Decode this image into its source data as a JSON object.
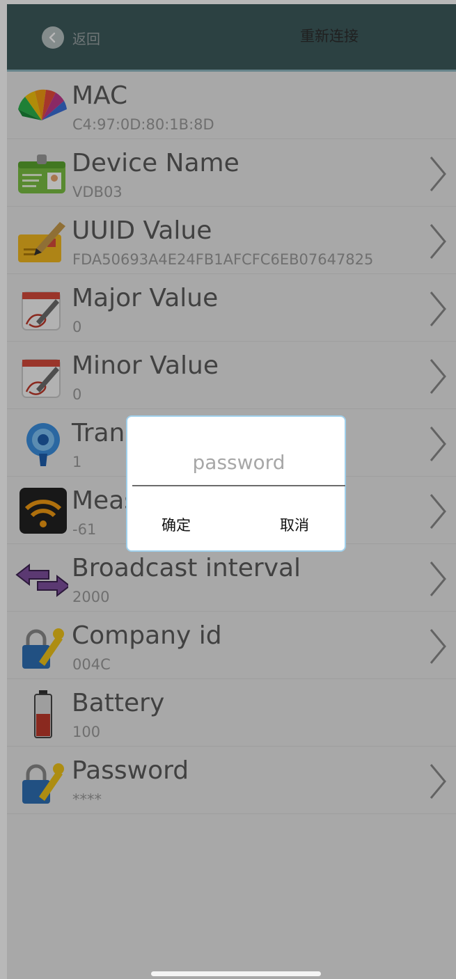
{
  "header": {
    "back_label": "返回",
    "reconnect_label": "重新连接"
  },
  "rows": [
    {
      "label": "MAC",
      "value": "C4:97:0D:80:1B:8D",
      "icon": "color-fan-icon",
      "chevron": false
    },
    {
      "label": "Device Name",
      "value": "VDB03",
      "icon": "id-card-icon",
      "chevron": true
    },
    {
      "label": "UUID Value",
      "value": "FDA50693A4E24FB1AFCFC6EB07647825",
      "icon": "pen-envelope-icon",
      "chevron": true
    },
    {
      "label": "Major Value",
      "value": "0",
      "icon": "calendar-pen-icon",
      "chevron": true
    },
    {
      "label": "Minor Value",
      "value": "0",
      "icon": "calendar-pen-icon",
      "chevron": true
    },
    {
      "label": "Trans",
      "value": "1",
      "icon": "location-pin-icon",
      "chevron": true
    },
    {
      "label": "Meas",
      "value": "-61",
      "icon": "wifi-signal-icon",
      "chevron": true
    },
    {
      "label": "Broadcast interval",
      "value": "2000",
      "icon": "double-arrow-icon",
      "chevron": true
    },
    {
      "label": "Company id",
      "value": "004C",
      "icon": "lock-key-icon",
      "chevron": true
    },
    {
      "label": "Battery",
      "value": "100",
      "icon": "battery-icon",
      "chevron": false
    },
    {
      "label": "Password",
      "value": "****",
      "icon": "lock-key-icon",
      "chevron": true
    }
  ],
  "dialog": {
    "placeholder": "password",
    "confirm_label": "确定",
    "cancel_label": "取消"
  }
}
